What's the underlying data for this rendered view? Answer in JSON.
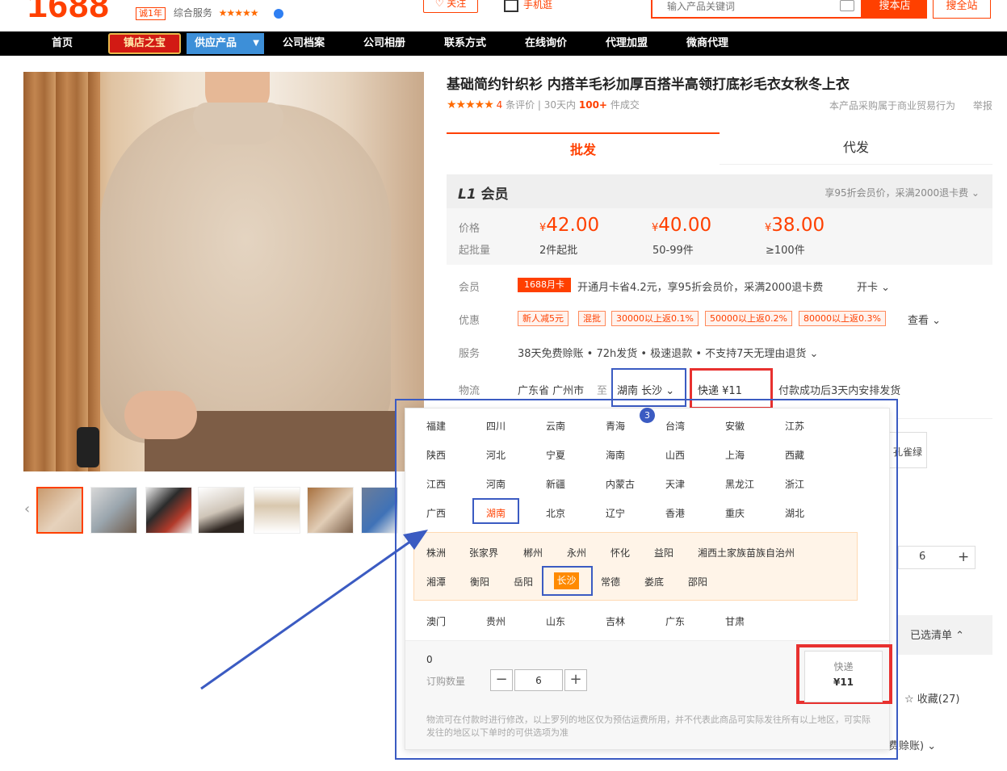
{
  "header": {
    "logo": "1688",
    "year_badge": "诚1年",
    "service_label": "综合服务",
    "service_stars": "★★★★★",
    "follow_label": "关注",
    "mobile_label": "手机逛",
    "search_placeholder": "输入产品关键词",
    "search_this_label": "搜本店",
    "search_all_label": "搜全站"
  },
  "nav": {
    "home": "首页",
    "treasure": "镇店之宝",
    "products": "供应产品",
    "archive": "公司档案",
    "album": "公司相册",
    "contact": "联系方式",
    "inquiry": "在线询价",
    "agent": "代理加盟",
    "wechat_agent": "微商代理"
  },
  "product": {
    "title": "基础简约针织衫 内搭羊毛衫加厚百搭半高领打底衫毛衣女秋冬上衣",
    "stars": "★★★★★",
    "review_count": "4",
    "review_label": "条评价",
    "sales_prefix": "30天内",
    "sales_count": "100+",
    "sales_suffix": "件成交",
    "biz_note": "本产品采购属于商业贸易行为",
    "report": "举报"
  },
  "tabs": {
    "wholesale": "批发",
    "dropship": "代发"
  },
  "member": {
    "level_prefix": "L1",
    "level_suffix": "会员",
    "note": "享95折会员价，采满2000退卡费 ⌄"
  },
  "pricing": {
    "price_label": "价格",
    "qty_label": "起批量",
    "currency": "¥",
    "tiers": [
      {
        "price": "42.00",
        "qty": "2件起批"
      },
      {
        "price": "40.00",
        "qty": "50-99件"
      },
      {
        "price": "38.00",
        "qty": "≥100件"
      }
    ]
  },
  "rows": {
    "member_label": "会员",
    "card_badge": "1688月卡",
    "card_text": "开通月卡省4.2元，享95折会员价，采满2000退卡费",
    "card_action": "开卡 ⌄",
    "promo_label": "优惠",
    "promos": [
      "新人减5元",
      "混批",
      "30000以上返0.1%",
      "50000以上返0.2%",
      "80000以上返0.3%"
    ],
    "promo_action": "查看 ⌄",
    "service_label": "服务",
    "service_text": "38天免费赊账 • 72h发货 • 极速退款 • 不支持7天无理由退货 ⌄",
    "logistics_label": "物流",
    "origin": "广东省 广州市",
    "to": "至",
    "destination": "湖南 长沙 ⌄",
    "express": "快递  ¥11",
    "ship_note": "付款成功后3天内安排发货"
  },
  "background": {
    "color_frag": "孔雀绿",
    "qty_frag": "6",
    "plus": "+",
    "selected_list": "已选清单 ⌃",
    "favorite": "☆ 收藏(27)",
    "credit_frag": "费赊账)  ⌄"
  },
  "panel": {
    "badge": "3",
    "provinces": [
      [
        "福建",
        "四川",
        "云南",
        "青海",
        "台湾",
        "安徽",
        "江苏"
      ],
      [
        "陕西",
        "河北",
        "宁夏",
        "海南",
        "山西",
        "上海",
        "西藏"
      ],
      [
        "江西",
        "河南",
        "新疆",
        "内蒙古",
        "天津",
        "黑龙江",
        "浙江"
      ],
      [
        "广西",
        "湖南",
        "北京",
        "辽宁",
        "香港",
        "重庆",
        "湖北"
      ]
    ],
    "cities_row1": [
      "株洲",
      "张家界",
      "郴州",
      "永州",
      "怀化",
      "益阳",
      "湘西土家族苗族自治州"
    ],
    "cities_row2": [
      "湘潭",
      "衡阳",
      "岳阳",
      "长沙",
      "常德",
      "娄底",
      "邵阳"
    ],
    "provinces_last": [
      "澳门",
      "贵州",
      "山东",
      "吉林",
      "广东",
      "甘肃"
    ],
    "zero": "0",
    "order_label": "订购数量",
    "minus": "−",
    "plus": "+",
    "quantity": "6",
    "express_title": "快递",
    "express_price": "¥11",
    "disclaimer": "物流可在付款时进行修改，以上罗列的地区仅为预估运费所用，并不代表此商品可实际发往所有以上地区，可实际发往的地区以下单时的可供选项为准"
  }
}
